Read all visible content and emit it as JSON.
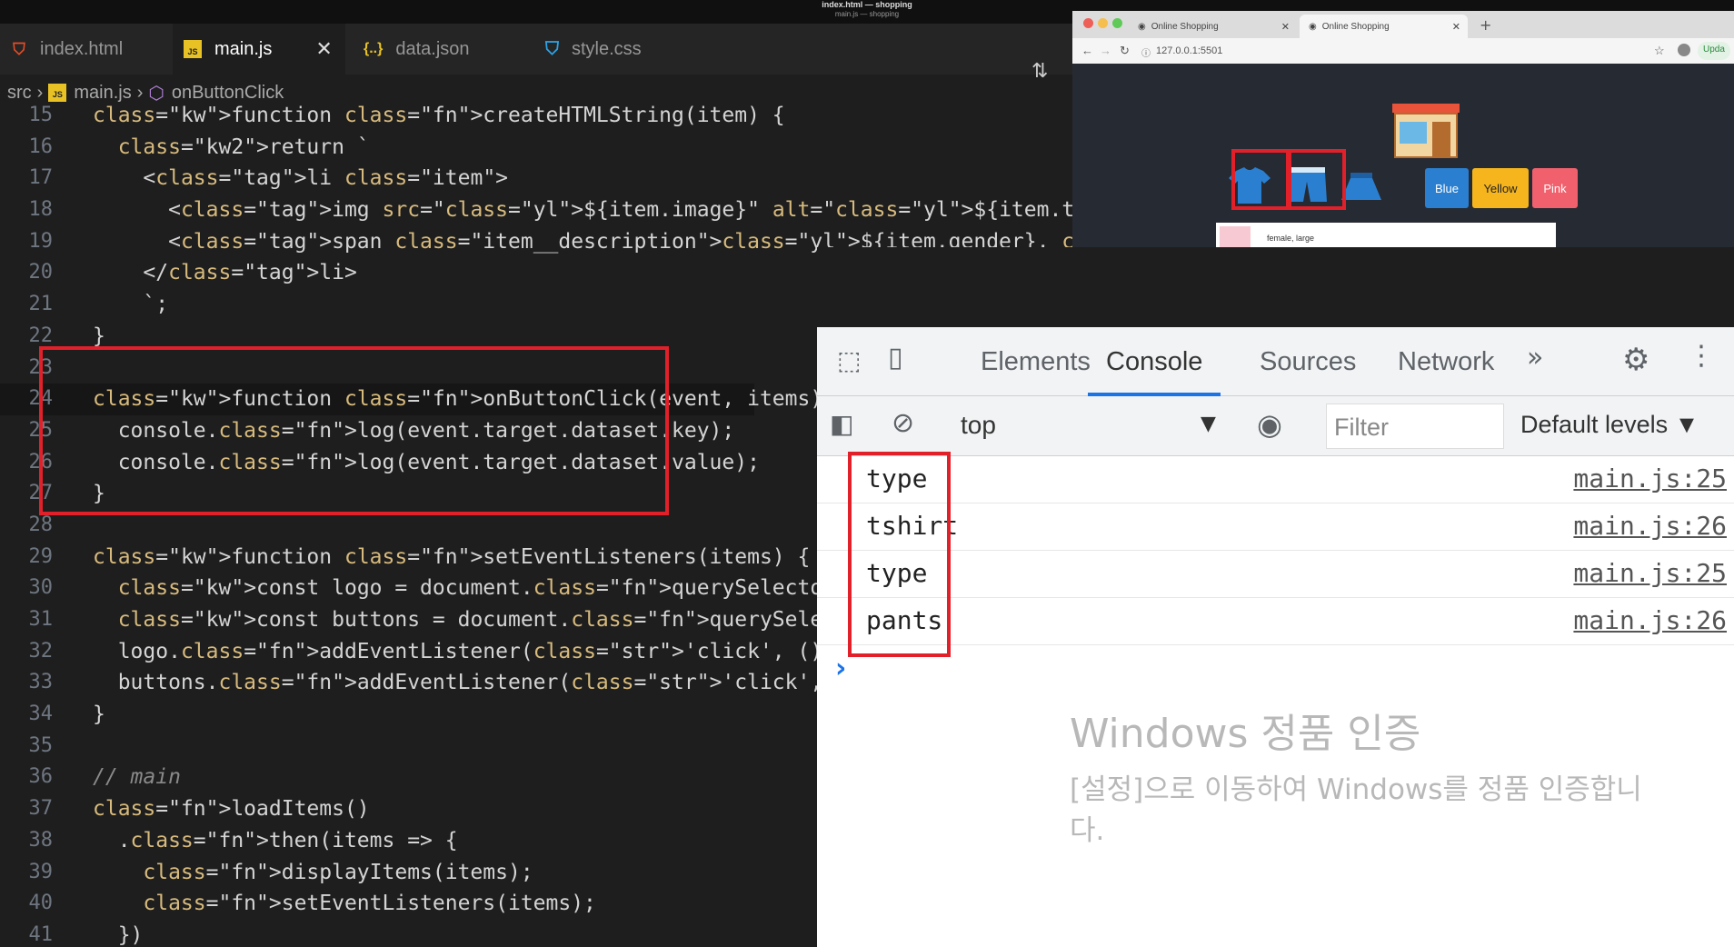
{
  "titlebar": {
    "title": "index.html — shopping",
    "subtitle": "main.js — shopping"
  },
  "tabs": [
    {
      "label": "index.html"
    },
    {
      "label": "main.js"
    },
    {
      "label": "data.json"
    },
    {
      "label": "style.css"
    }
  ],
  "breadcrumb": {
    "folder": "src",
    "file": "main.js",
    "symbol": "onButtonClick"
  },
  "code_lines": [
    {
      "n": "15",
      "text": "function createHTMLString(item) {"
    },
    {
      "n": "16",
      "text": "  return `"
    },
    {
      "n": "17",
      "text": "    <li class=\"item\">"
    },
    {
      "n": "18",
      "text": "      <img src=\"${item.image}\" alt=\"${item.type}\" class=\"item__thumbnail\" />"
    },
    {
      "n": "19",
      "text": "      <span class=\"item__description\">${item.gender}, ${item.size}</span>"
    },
    {
      "n": "20",
      "text": "    </li>"
    },
    {
      "n": "21",
      "text": "    `;"
    },
    {
      "n": "22",
      "text": "}"
    },
    {
      "n": "23",
      "text": ""
    },
    {
      "n": "24",
      "text": "function onButtonClick(event, items) {"
    },
    {
      "n": "25",
      "text": "  console.log(event.target.dataset.key);"
    },
    {
      "n": "26",
      "text": "  console.log(event.target.dataset.value);"
    },
    {
      "n": "27",
      "text": "}"
    },
    {
      "n": "28",
      "text": ""
    },
    {
      "n": "29",
      "text": "function setEventListeners(items) {"
    },
    {
      "n": "30",
      "text": "  const logo = document.querySelector('.logo');"
    },
    {
      "n": "31",
      "text": "  const buttons = document.querySelector('.buttons');"
    },
    {
      "n": "32",
      "text": "  logo.addEventListener('click', () => displayItems(i"
    },
    {
      "n": "33",
      "text": "  buttons.addEventListener('click', event => onButto"
    },
    {
      "n": "34",
      "text": "}"
    },
    {
      "n": "35",
      "text": ""
    },
    {
      "n": "36",
      "text": "// main"
    },
    {
      "n": "37",
      "text": "loadItems()"
    },
    {
      "n": "38",
      "text": "  .then(items => {"
    },
    {
      "n": "39",
      "text": "    displayItems(items);"
    },
    {
      "n": "40",
      "text": "    setEventListeners(items);"
    },
    {
      "n": "41",
      "text": "  })"
    }
  ],
  "browser": {
    "tab1": "Online Shopping",
    "tab2": "Online Shopping",
    "url": "127.0.0.1:5501",
    "update_label": "Upda",
    "buttons": [
      "Blue",
      "Yellow",
      "Pink"
    ],
    "item_text": "female, large"
  },
  "devtools": {
    "tabs": [
      "Elements",
      "Console",
      "Sources",
      "Network"
    ],
    "context": "top",
    "filter_placeholder": "Filter",
    "levels": "Default levels ▼",
    "logs": [
      {
        "msg": "type",
        "src": "main.js:25"
      },
      {
        "msg": "tshirt",
        "src": "main.js:26"
      },
      {
        "msg": "type",
        "src": "main.js:25"
      },
      {
        "msg": "pants",
        "src": "main.js:26"
      }
    ],
    "prompt": "›"
  },
  "watermark": {
    "title": "Windows 정품 인증",
    "line1": "[설정]으로 이동하여 Windows를 정품 인증합니",
    "line2": "다."
  }
}
